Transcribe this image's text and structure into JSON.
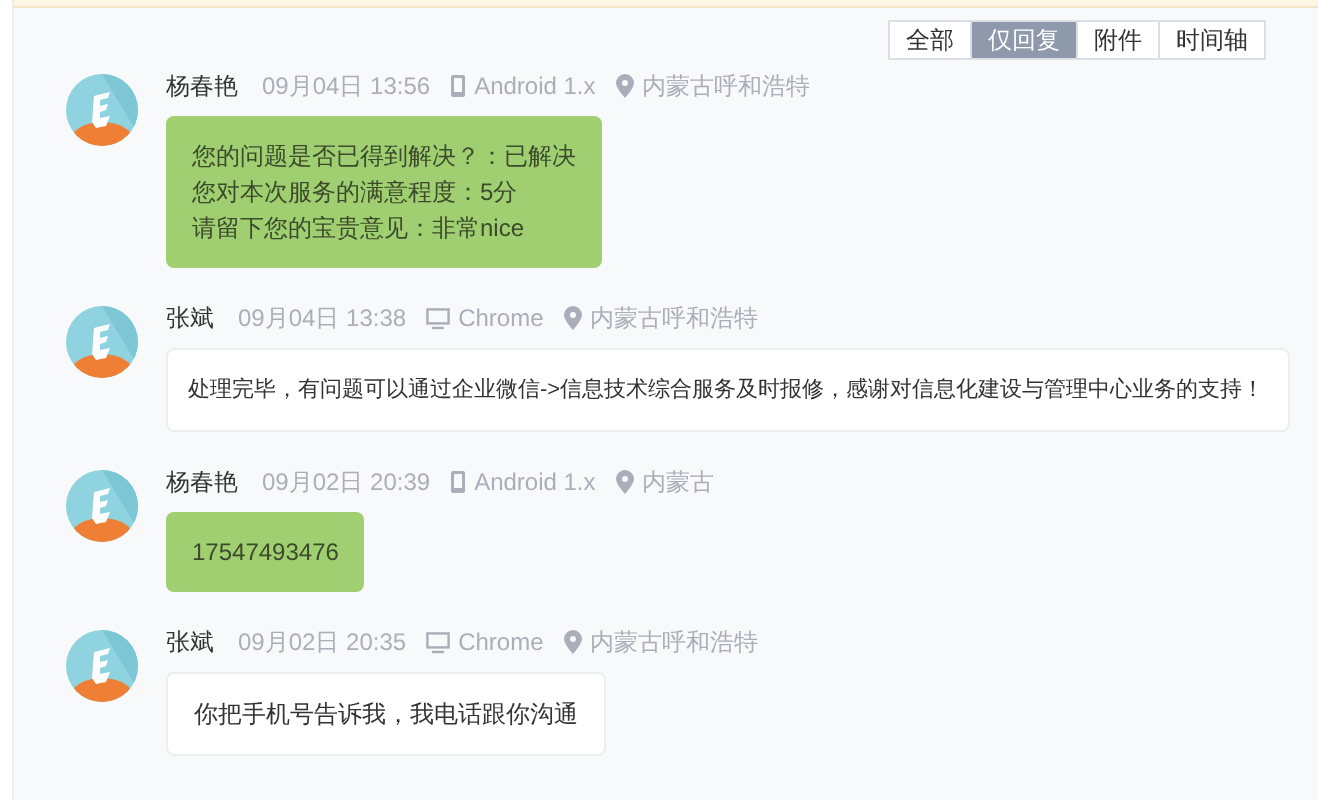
{
  "filter_tabs": [
    {
      "label": "全部",
      "selected": false
    },
    {
      "label": "仅回复",
      "selected": true
    },
    {
      "label": "附件",
      "selected": false
    },
    {
      "label": "时间轴",
      "selected": false
    }
  ],
  "messages": [
    {
      "author": "杨春艳",
      "time": "09月04日 13:56",
      "device": {
        "kind": "phone",
        "label": "Android 1.x"
      },
      "location": "内蒙古呼和浩特",
      "kind": "customer",
      "lines": [
        "您的问题是否已得到解决？：已解决",
        "您对本次服务的满意程度：5分",
        "请留下您的宝贵意见：非常nice"
      ]
    },
    {
      "author": "张斌",
      "time": "09月04日 13:38",
      "device": {
        "kind": "desktop",
        "label": "Chrome"
      },
      "location": "内蒙古呼和浩特",
      "kind": "staff",
      "lines": [
        "处理完毕，有问题可以通过企业微信->信息技术综合服务及时报修，感谢对信息化建设与管理中心业务的支持！"
      ]
    },
    {
      "author": "杨春艳",
      "time": "09月02日 20:39",
      "device": {
        "kind": "phone",
        "label": "Android 1.x"
      },
      "location": "内蒙古",
      "kind": "customer",
      "lines": [
        "17547493476"
      ]
    },
    {
      "author": "张斌",
      "time": "09月02日 20:35",
      "device": {
        "kind": "desktop",
        "label": "Chrome"
      },
      "location": "内蒙古呼和浩特",
      "kind": "staff",
      "lines": [
        "你把手机号告诉我，我电话跟你沟通"
      ]
    }
  ]
}
